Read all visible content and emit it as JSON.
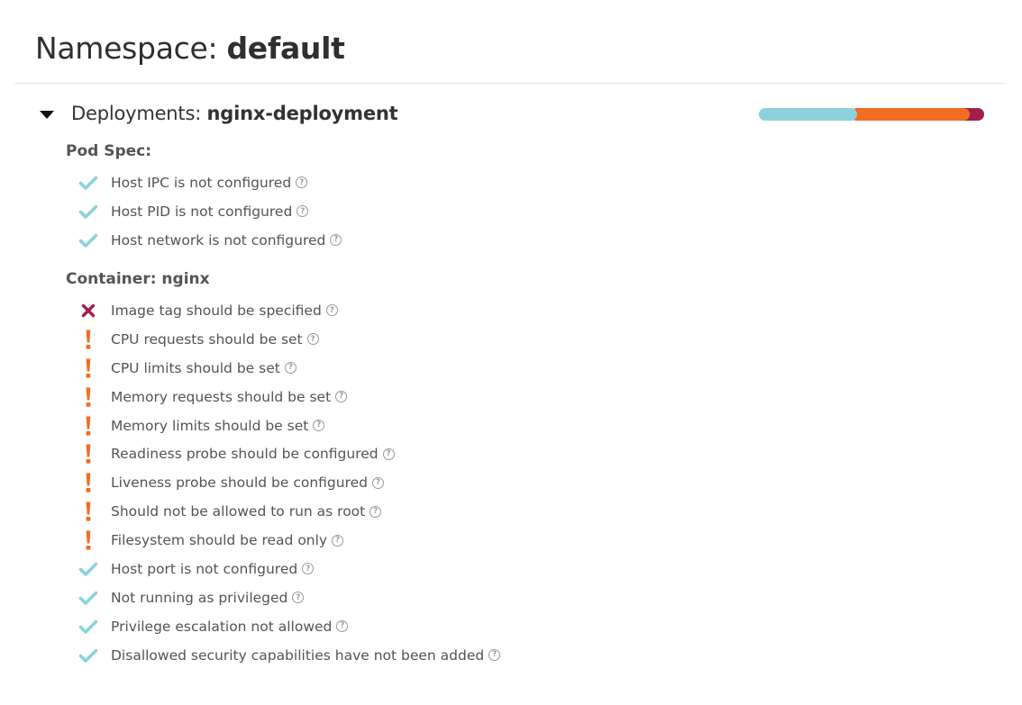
{
  "header": {
    "prefix": "Namespace: ",
    "namespace": "default"
  },
  "deployment": {
    "kind_label": "Deployments: ",
    "name": "nginx-deployment",
    "expanded": true,
    "score_bar": {
      "passing_fraction": 0.4375,
      "warning_fraction": 0.5,
      "error_fraction": 0.0625,
      "colors": {
        "passing": "#8bd2dc",
        "warning": "#f26c21",
        "error": "#a11f4c"
      }
    }
  },
  "sections": [
    {
      "title": "Pod Spec:",
      "checks": [
        {
          "status": "success",
          "icon": "check-icon",
          "text": "Host IPC is not configured"
        },
        {
          "status": "success",
          "icon": "check-icon",
          "text": "Host PID is not configured"
        },
        {
          "status": "success",
          "icon": "check-icon",
          "text": "Host network is not configured"
        }
      ]
    },
    {
      "title": "Container: nginx",
      "checks": [
        {
          "status": "error",
          "icon": "x-icon",
          "text": "Image tag should be specified"
        },
        {
          "status": "warning",
          "icon": "exclamation-icon",
          "text": "CPU requests should be set"
        },
        {
          "status": "warning",
          "icon": "exclamation-icon",
          "text": "CPU limits should be set"
        },
        {
          "status": "warning",
          "icon": "exclamation-icon",
          "text": "Memory requests should be set"
        },
        {
          "status": "warning",
          "icon": "exclamation-icon",
          "text": "Memory limits should be set"
        },
        {
          "status": "warning",
          "icon": "exclamation-icon",
          "text": "Readiness probe should be configured"
        },
        {
          "status": "warning",
          "icon": "exclamation-icon",
          "text": "Liveness probe should be configured"
        },
        {
          "status": "warning",
          "icon": "exclamation-icon",
          "text": "Should not be allowed to run as root"
        },
        {
          "status": "warning",
          "icon": "exclamation-icon",
          "text": "Filesystem should be read only"
        },
        {
          "status": "success",
          "icon": "check-icon",
          "text": "Host port is not configured"
        },
        {
          "status": "success",
          "icon": "check-icon",
          "text": "Not running as privileged"
        },
        {
          "status": "success",
          "icon": "check-icon",
          "text": "Privilege escalation not allowed"
        },
        {
          "status": "success",
          "icon": "check-icon",
          "text": "Disallowed security capabilities have not been added"
        }
      ]
    }
  ],
  "help_glyph": "?",
  "status_colors": {
    "success": "#8bd2dc",
    "warning": "#f26c21",
    "error": "#a11f4c"
  }
}
